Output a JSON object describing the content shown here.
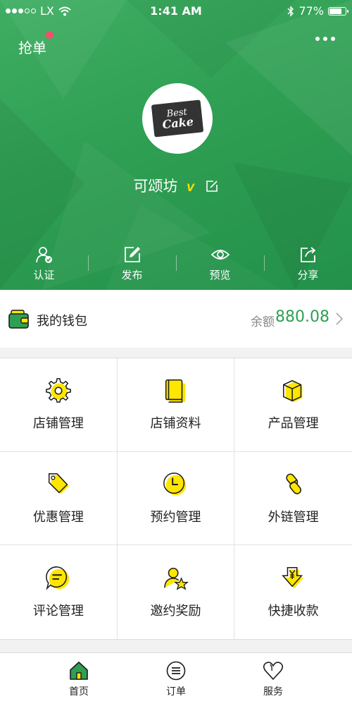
{
  "status_bar": {
    "carrier": "LX",
    "time": "1:41 AM",
    "battery_percent": "77%",
    "battery_level": 0.77,
    "signal_bars": 3
  },
  "header": {
    "grab_label": "抢单",
    "store_name": "可颂坊",
    "verified_mark": "V",
    "logo": {
      "line1": "Best",
      "line2": "Cake"
    },
    "actions": [
      {
        "label": "认证",
        "icon": "verify-user-icon"
      },
      {
        "label": "发布",
        "icon": "publish-edit-icon"
      },
      {
        "label": "预览",
        "icon": "eye-icon"
      },
      {
        "label": "分享",
        "icon": "share-icon"
      }
    ]
  },
  "wallet": {
    "title": "我的钱包",
    "balance_label": "余额",
    "balance": "880.08"
  },
  "grid": [
    {
      "label": "店铺管理",
      "icon": "gear-icon"
    },
    {
      "label": "店铺资料",
      "icon": "book-icon"
    },
    {
      "label": "产品管理",
      "icon": "box-icon"
    },
    {
      "label": "优惠管理",
      "icon": "tag-icon"
    },
    {
      "label": "预约管理",
      "icon": "clock-icon"
    },
    {
      "label": "外链管理",
      "icon": "link-icon"
    },
    {
      "label": "评论管理",
      "icon": "comment-icon"
    },
    {
      "label": "邀约奖励",
      "icon": "user-star-icon"
    },
    {
      "label": "快捷收款",
      "icon": "yen-download-icon"
    }
  ],
  "tabbar": [
    {
      "label": "首页",
      "icon": "home-icon",
      "active": true
    },
    {
      "label": "订单",
      "icon": "list-icon",
      "active": false
    },
    {
      "label": "服务",
      "icon": "heart-icon",
      "active": false
    }
  ],
  "colors": {
    "brand_green": "#2f9f53",
    "accent_yellow": "#ffe600",
    "badge_red": "#f0506e"
  }
}
